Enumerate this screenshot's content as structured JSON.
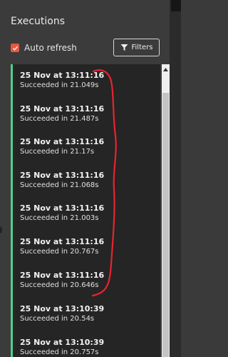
{
  "header": {
    "title": "Executions"
  },
  "controls": {
    "auto_refresh_label": "Auto refresh",
    "auto_refresh_checked": true,
    "filters_label": "Filters"
  },
  "executions": [
    {
      "time": "25 Nov at 13:11:16",
      "status": "Succeeded in 21.049s"
    },
    {
      "time": "25 Nov at 13:11:16",
      "status": "Succeeded in 21.487s"
    },
    {
      "time": "25 Nov at 13:11:16",
      "status": "Succeeded in 21.17s"
    },
    {
      "time": "25 Nov at 13:11:16",
      "status": "Succeeded in 21.068s"
    },
    {
      "time": "25 Nov at 13:11:16",
      "status": "Succeeded in 21.003s"
    },
    {
      "time": "25 Nov at 13:11:16",
      "status": "Succeeded in 20.767s"
    },
    {
      "time": "25 Nov at 13:11:16",
      "status": "Succeeded in 20.646s"
    },
    {
      "time": "25 Nov at 13:10:39",
      "status": "Succeeded in 20.54s"
    },
    {
      "time": "25 Nov at 13:10:39",
      "status": "Succeeded in 20.757s"
    }
  ],
  "colors": {
    "accent_success": "#4fcf8f",
    "checkbox": "#e9573f",
    "annotation": "#e8242f"
  },
  "icons": {
    "checkbox": "checkmark-icon",
    "filters": "funnel-icon",
    "scroll_up": "chevron-up-icon"
  }
}
